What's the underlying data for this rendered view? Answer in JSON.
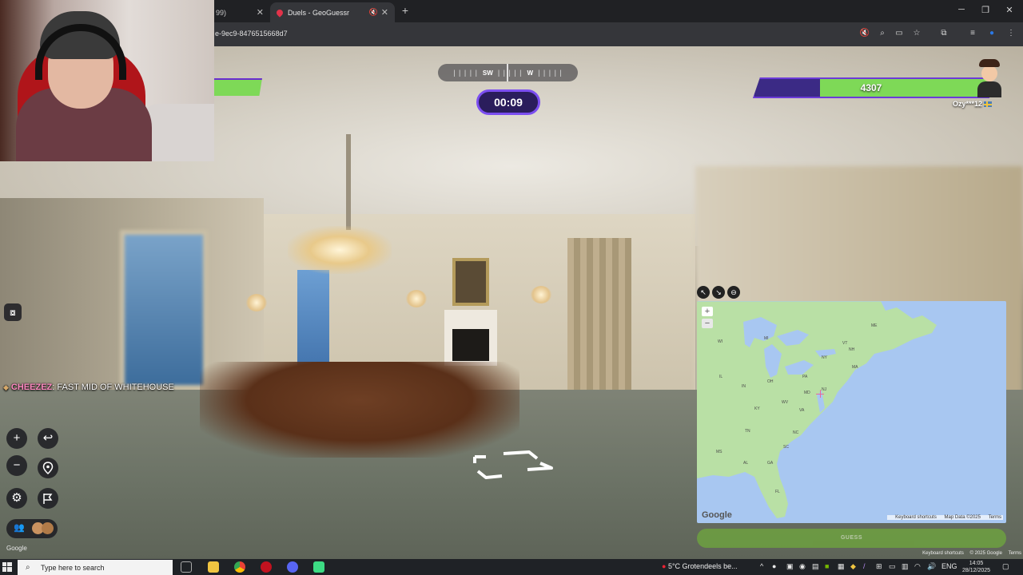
{
  "browser": {
    "tabs": [
      {
        "title": "99)",
        "active": false
      },
      {
        "title": "Duels - GeoGuessr",
        "active": true
      }
    ],
    "url": "e-9ec9-8476515668d7",
    "icons": [
      "mute-site-icon",
      "zoom-icon",
      "cast-icon",
      "bookmark-star-icon",
      "extensions-icon",
      "media-icon",
      "profile-icon",
      "menu-icon"
    ]
  },
  "game": {
    "opponent_health": "4307",
    "opponent_health_fraction": 0.72,
    "opponent_name": "Ozy***12",
    "compass": {
      "left": "SW",
      "right": "W"
    },
    "timer": "00:09",
    "chat": {
      "user": "CHEEZEZ",
      "separator": ": ",
      "message": "FAST MID OF WHITEHOUSE"
    },
    "google_mark": "Google"
  },
  "map": {
    "google_logo": "Google",
    "attribution": [
      "Keyboard shortcuts",
      "Map Data ©2025",
      "Terms"
    ],
    "guess_label": "GUESS",
    "state_labels": [
      "WI",
      "MI",
      "IL",
      "IN",
      "OH",
      "PA",
      "NY",
      "VT",
      "NH",
      "ME",
      "MA",
      "KY",
      "WV",
      "VA",
      "MD",
      "NJ",
      "TN",
      "NC",
      "SC",
      "GA",
      "AL",
      "MS",
      "FL"
    ]
  },
  "page_attribution": [
    "Keyboard shortcuts",
    "© 2025 Google",
    "Terms"
  ],
  "taskbar": {
    "search_placeholder": "Type here to search",
    "weather": "5°C  Grotendeels be...",
    "language": "ENG",
    "time": "14:05",
    "date": "28/12/2025"
  },
  "colors": {
    "health_green": "#7ed957",
    "health_purple": "#3b2a85",
    "timer_border": "#7b4ef0",
    "map_water": "#a8c7f1",
    "map_land": "#b9e0a5"
  }
}
